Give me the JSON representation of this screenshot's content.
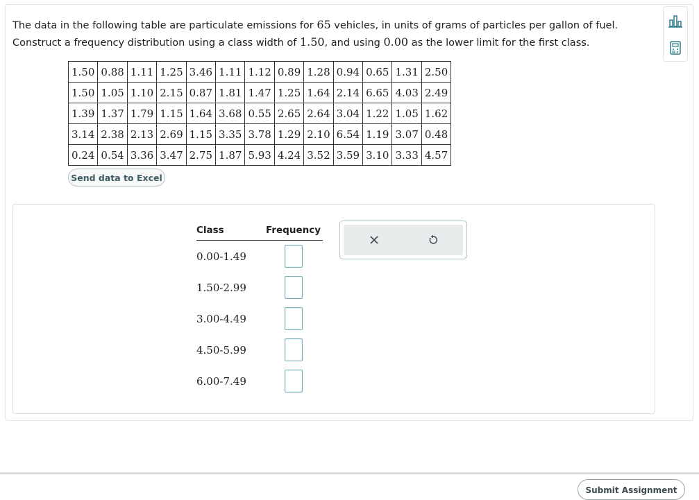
{
  "question": {
    "part1": "The data in the following table are particulate emissions for ",
    "count": "65",
    "part2": " vehicles, in units of grams of particles per gallon of fuel. Construct a frequency distribution using a class width of ",
    "class_width": "1.50",
    "part3": ", and using ",
    "lower_limit": "0.00",
    "part4": " as the lower limit for the first class."
  },
  "side_tools": {
    "stats_icon": "bar-chart-icon",
    "calculator_icon": "calculator-icon"
  },
  "data_table": [
    [
      "1.50",
      "0.88",
      "1.11",
      "1.25",
      "3.46",
      "1.11",
      "1.12",
      "0.89",
      "1.28",
      "0.94",
      "0.65",
      "1.31",
      "2.50"
    ],
    [
      "1.50",
      "1.05",
      "1.10",
      "2.15",
      "0.87",
      "1.81",
      "1.47",
      "1.25",
      "1.64",
      "2.14",
      "6.65",
      "4.03",
      "2.49"
    ],
    [
      "1.39",
      "1.37",
      "1.79",
      "1.15",
      "1.64",
      "3.68",
      "0.55",
      "2.65",
      "2.64",
      "3.04",
      "1.22",
      "1.05",
      "1.62"
    ],
    [
      "3.14",
      "2.38",
      "2.13",
      "2.69",
      "1.15",
      "3.35",
      "3.78",
      "1.29",
      "2.10",
      "6.54",
      "1.19",
      "3.07",
      "0.48"
    ],
    [
      "0.24",
      "0.54",
      "3.36",
      "3.47",
      "2.75",
      "1.87",
      "5.93",
      "4.24",
      "3.52",
      "3.59",
      "3.10",
      "3.33",
      "4.57"
    ]
  ],
  "excel_button": "Send data to Excel",
  "frequency_table": {
    "header_class": "Class",
    "header_frequency": "Frequency",
    "rows": [
      {
        "class": "0.00-1.49",
        "frequency": ""
      },
      {
        "class": "1.50-2.99",
        "frequency": ""
      },
      {
        "class": "3.00-4.49",
        "frequency": ""
      },
      {
        "class": "4.50-5.99",
        "frequency": ""
      },
      {
        "class": "6.00-7.49",
        "frequency": ""
      }
    ]
  },
  "actions": {
    "clear_icon": "close-icon",
    "reset_icon": "undo-icon"
  },
  "footer": {
    "submit_label": "Submit Assignment"
  },
  "colors": {
    "accent": "#7bb0b8",
    "panel_bg": "#e8ebec"
  }
}
